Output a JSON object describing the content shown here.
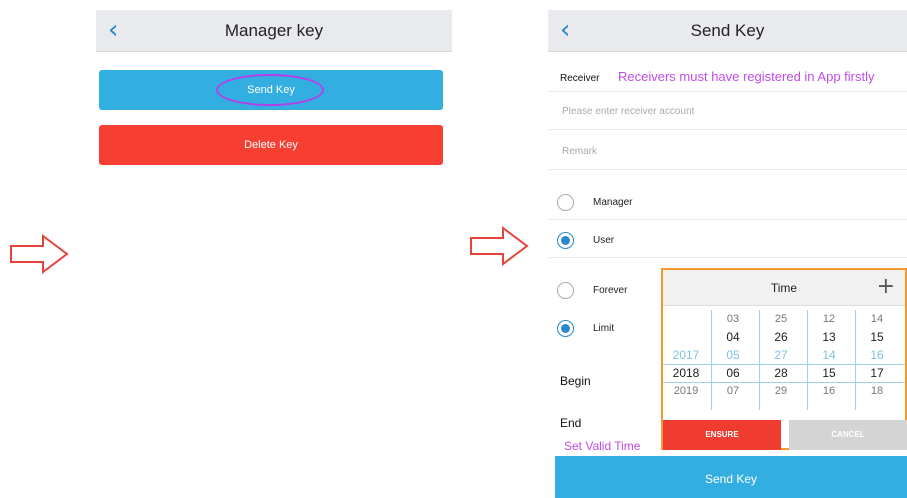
{
  "left_screen": {
    "title": "Manager key",
    "back_icon": "chevron-left-icon",
    "send_key_button": "Send Key",
    "delete_key_button": "Delete Key"
  },
  "right_screen": {
    "title": "Send Key",
    "back_icon": "chevron-left-icon",
    "receiver_label": "Receiver",
    "receiver_hint": "Receivers must have registered in App firstly",
    "account_placeholder": "Please enter receiver account",
    "remark_placeholder": "Remark",
    "role_options": [
      {
        "label": "Manager",
        "checked": false
      },
      {
        "label": "User",
        "checked": true
      }
    ],
    "duration_options": [
      {
        "label": "Forever",
        "checked": false
      },
      {
        "label": "Limit",
        "checked": true
      }
    ],
    "begin_label": "Begin",
    "end_label": "End",
    "valid_time_hint": "Set Valid Time",
    "send_key_button": "Send Key"
  },
  "time_picker": {
    "title": "Time",
    "add_icon": "plus-icon",
    "columns": {
      "year": [
        "",
        "",
        "2017",
        "2018",
        "2019"
      ],
      "month": [
        "03",
        "04",
        "05",
        "06",
        "07"
      ],
      "day": [
        "25",
        "26",
        "27",
        "28",
        "29"
      ],
      "hour": [
        "12",
        "13",
        "14",
        "15",
        "16"
      ],
      "minute": [
        "14",
        "15",
        "16",
        "17",
        "18"
      ]
    },
    "ensure_button": "ENSURE",
    "cancel_button": "CANCEL"
  },
  "annotation_colors": {
    "highlight": "#b340e8",
    "picker_border": "#f29a2e",
    "arrow": "#e8433a",
    "accent": "#33aee0",
    "danger": "#f63e32"
  }
}
